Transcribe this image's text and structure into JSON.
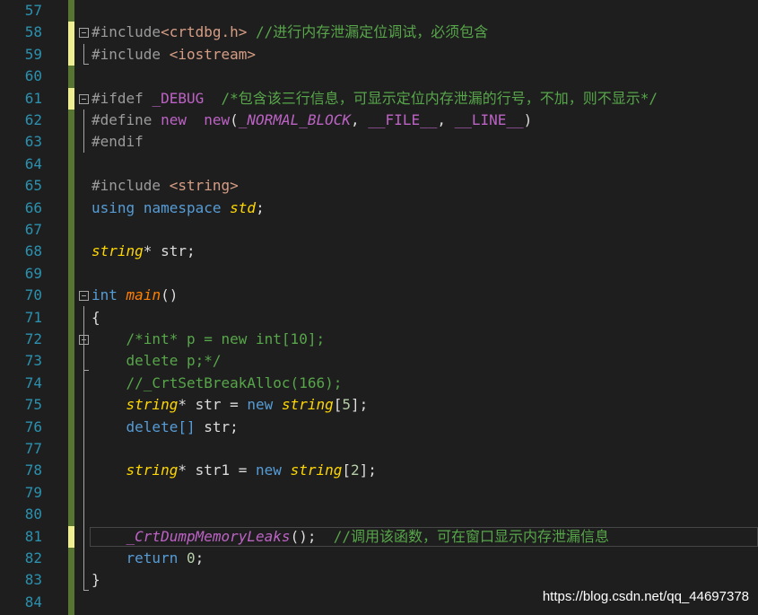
{
  "lines": [
    {
      "n": "57"
    },
    {
      "n": "58"
    },
    {
      "n": "59"
    },
    {
      "n": "60"
    },
    {
      "n": "61"
    },
    {
      "n": "62"
    },
    {
      "n": "63"
    },
    {
      "n": "64"
    },
    {
      "n": "65"
    },
    {
      "n": "66"
    },
    {
      "n": "67"
    },
    {
      "n": "68"
    },
    {
      "n": "69"
    },
    {
      "n": "70"
    },
    {
      "n": "71"
    },
    {
      "n": "72"
    },
    {
      "n": "73"
    },
    {
      "n": "74"
    },
    {
      "n": "75"
    },
    {
      "n": "76"
    },
    {
      "n": "77"
    },
    {
      "n": "78"
    },
    {
      "n": "79"
    },
    {
      "n": "80"
    },
    {
      "n": "81"
    },
    {
      "n": "82"
    },
    {
      "n": "83"
    },
    {
      "n": "84"
    }
  ],
  "code": {
    "l58_a": "#include",
    "l58_b": "<crtdbg.h>",
    "l58_c": " //进行内存泄漏定位调试，必须包含",
    "l59_a": "#include ",
    "l59_b": "<iostream>",
    "l61_a": "#ifdef ",
    "l61_b": "_DEBUG",
    "l61_c": "  /*包含该三行信息，可显示定位内存泄漏的行号，不加，则不显示*/",
    "l62_a": "#define ",
    "l62_b": "new",
    "l62_c": "  ",
    "l62_d": "new",
    "l62_e": "(",
    "l62_f": "_NORMAL_BLOCK",
    "l62_g": ", ",
    "l62_h": "__FILE__",
    "l62_i": ", ",
    "l62_j": "__LINE__",
    "l62_k": ")",
    "l63_a": "#endif",
    "l65_a": "#include ",
    "l65_b": "<string>",
    "l66_a": "using",
    "l66_b": " ",
    "l66_c": "namespace",
    "l66_d": " ",
    "l66_e": "std",
    "l66_f": ";",
    "l68_a": "string",
    "l68_b": "* str;",
    "l70_a": "int",
    "l70_b": " ",
    "l70_c": "main",
    "l70_d": "()",
    "l71_a": "{",
    "l72_a": "    /*int* p = new int[10];",
    "l73_a": "    delete p;*/",
    "l74_a": "    //_CrtSetBreakAlloc(166);",
    "l75_a": "    ",
    "l75_b": "string",
    "l75_c": "* str = ",
    "l75_d": "new",
    "l75_e": " ",
    "l75_f": "string",
    "l75_g": "[",
    "l75_h": "5",
    "l75_i": "];",
    "l76_a": "    ",
    "l76_b": "delete[]",
    "l76_c": " str;",
    "l78_a": "    ",
    "l78_b": "string",
    "l78_c": "* str1 = ",
    "l78_d": "new",
    "l78_e": " ",
    "l78_f": "string",
    "l78_g": "[",
    "l78_h": "2",
    "l78_i": "];",
    "l81_a": "    ",
    "l81_b": "_CrtDumpMemoryLeaks",
    "l81_c": "();  ",
    "l81_d": "//调用该函数，可在窗口显示内存泄漏信息",
    "l82_a": "    ",
    "l82_b": "return",
    "l82_c": " ",
    "l82_d": "0",
    "l82_e": ";",
    "l83_a": "}"
  },
  "watermark": "https://blog.csdn.net/qq_44697378"
}
